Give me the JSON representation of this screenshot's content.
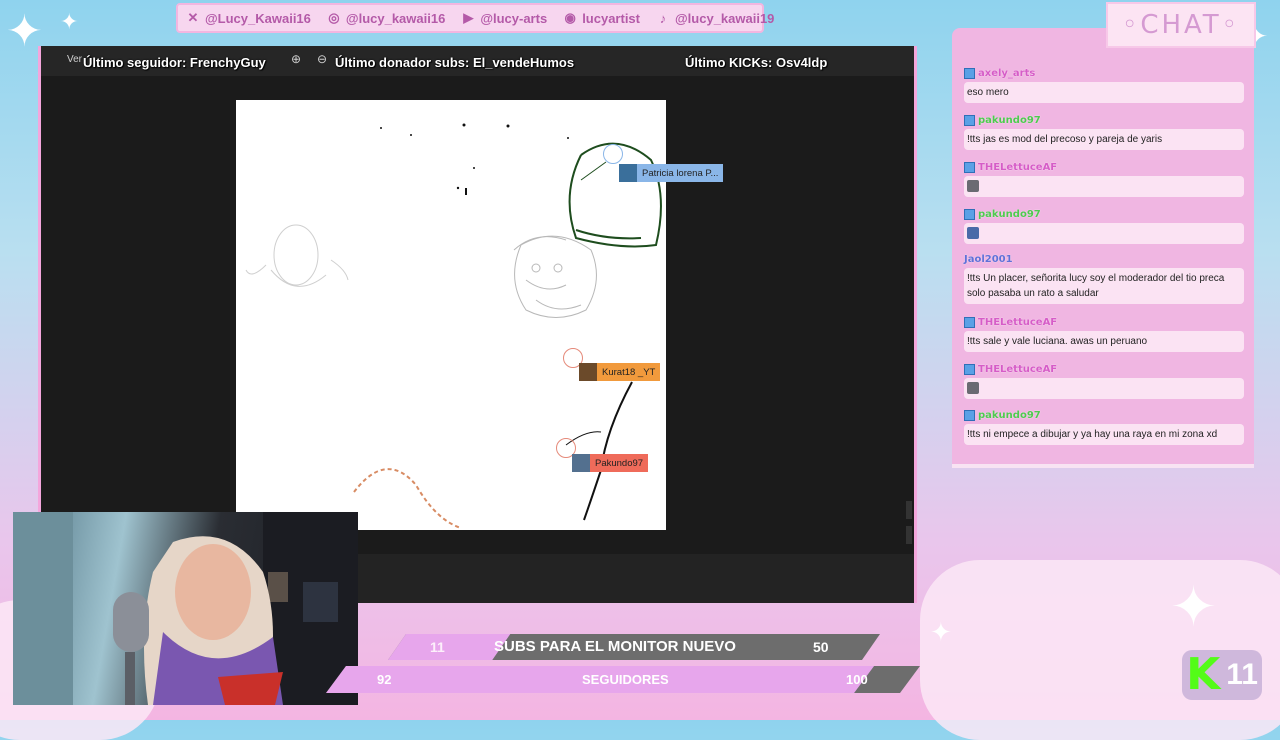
{
  "socials": [
    {
      "icon": "x-icon",
      "glyph": "✕",
      "handle": "@Lucy_Kawaii16"
    },
    {
      "icon": "instagram-icon",
      "glyph": "◎",
      "handle": "@lucy_kawaii16"
    },
    {
      "icon": "youtube-icon",
      "glyph": "▶",
      "handle": "@lucy-arts"
    },
    {
      "icon": "discord-icon",
      "glyph": "◉",
      "handle": "lucyartist"
    },
    {
      "icon": "tiktok-icon",
      "glyph": "♪",
      "handle": "@lucy_kawaii19"
    }
  ],
  "tickers": {
    "follower": "Último seguidor: FrenchyGuy",
    "donor": "Último donador subs: El_vendeHumos",
    "kicks": "Último KICKs: Osv4ldp"
  },
  "toolbar": {
    "ver": "Ver"
  },
  "cursors": [
    {
      "name": "Patricia lorena P...",
      "color": "#8ab6e8"
    },
    {
      "name": "Kurat18 _YT",
      "color": "#f19a3c"
    },
    {
      "name": "Pakundo97",
      "color": "#ef6b5a"
    }
  ],
  "goals": {
    "subs": {
      "current": "11",
      "label": "SUBS PARA EL MONITOR NUEVO",
      "target": "50",
      "progress": 0.22
    },
    "followers": {
      "current": "92",
      "label": "SEGUIDORES",
      "target": "100",
      "progress": 0.92
    }
  },
  "chat": {
    "title": "◦CHAT◦",
    "messages": [
      {
        "user": "axely_arts",
        "color": "#d65cc7",
        "text": "eso mero"
      },
      {
        "user": "pakundo97",
        "color": "#4fc94f",
        "text": "!tts jas es mod del precoso y pareja de yaris"
      },
      {
        "user": "THELettuceAF",
        "color": "#d65cc7",
        "text": "",
        "emote": "stare-emote"
      },
      {
        "user": "pakundo97",
        "color": "#4fc94f",
        "text": "",
        "emote": "cat-emote"
      },
      {
        "user": "Jaol2001",
        "color": "#6070d8",
        "text": "!tts Un placer, señorita lucy soy el moderador del tio preca solo pasaba un rato a saludar"
      },
      {
        "user": "THELettuceAF",
        "color": "#d65cc7",
        "text": "!tts sale y vale luciana. awas un peruano"
      },
      {
        "user": "THELettuceAF",
        "color": "#d65cc7",
        "text": "",
        "emote": "stare-emote"
      },
      {
        "user": "pakundo97",
        "color": "#4fc94f",
        "text": "!tts ni empece a dibujar y ya hay una raya en mi zona xd"
      }
    ]
  },
  "kick_badge": {
    "letter": "K",
    "count": "11"
  }
}
